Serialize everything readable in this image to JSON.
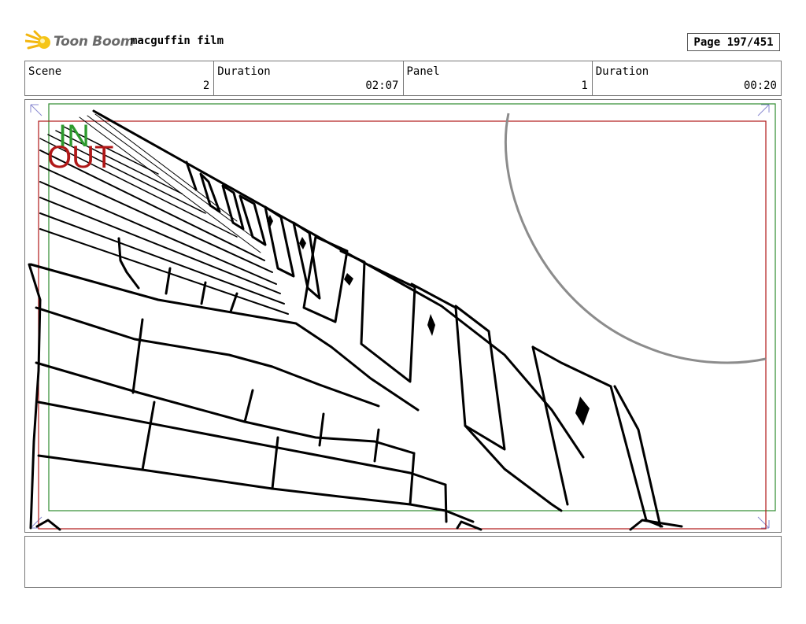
{
  "header": {
    "brand_name": "Toon Boom",
    "project_title": "macguffin film",
    "page_label": "Page 197/451"
  },
  "info_bar": [
    {
      "label": "Scene",
      "value": "2"
    },
    {
      "label": "Duration",
      "value": "02:07"
    },
    {
      "label": "Panel",
      "value": "1"
    },
    {
      "label": "Duration",
      "value": "00:20"
    }
  ],
  "panel": {
    "in_label": "IN",
    "out_label": "OUT",
    "colors": {
      "in": "#2e9b2e",
      "out": "#b01818",
      "sketch": "#000000",
      "sun": "#8c8c8c"
    }
  },
  "notes": {
    "text": ""
  }
}
